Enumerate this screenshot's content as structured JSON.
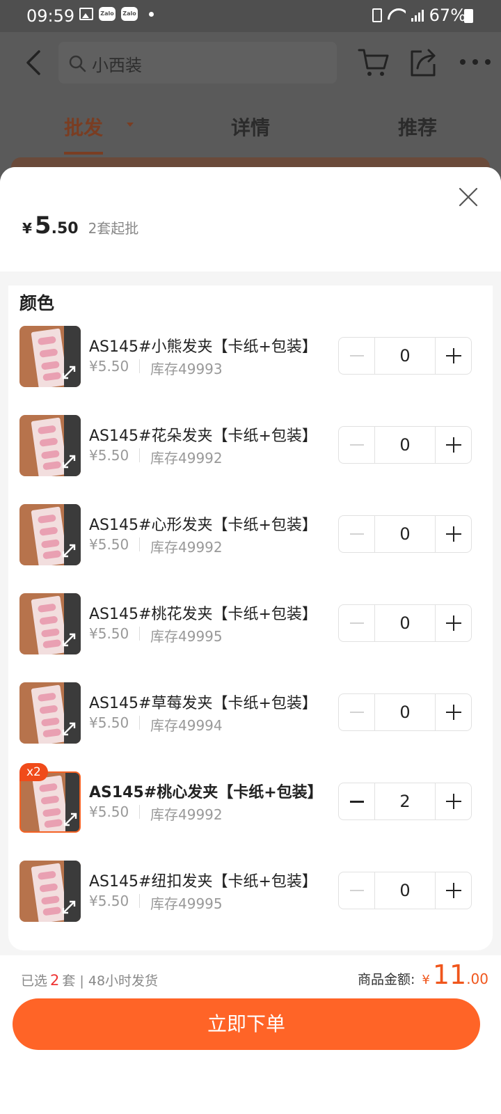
{
  "status_bar": {
    "time": "09:59",
    "battery": "67%",
    "zalo_label": "Zalo"
  },
  "top_bar": {
    "search_placeholder": "小西装"
  },
  "tabs": [
    {
      "label": "批发",
      "active": true
    },
    {
      "label": "详情",
      "active": false
    },
    {
      "label": "推荐",
      "active": false
    }
  ],
  "sheet": {
    "price_symbol": "¥",
    "price_int": "5",
    "price_dec": ".50",
    "moq": "2套起批",
    "section_title": "颜色"
  },
  "items": [
    {
      "name": "AS145#小熊发夹【卡纸+包装】",
      "price": "¥5.50",
      "stock": "库存49993",
      "qty": "0"
    },
    {
      "name": "AS145#花朵发夹【卡纸+包装】",
      "price": "¥5.50",
      "stock": "库存49992",
      "qty": "0"
    },
    {
      "name": "AS145#心形发夹【卡纸+包装】",
      "price": "¥5.50",
      "stock": "库存49992",
      "qty": "0"
    },
    {
      "name": "AS145#桃花发夹【卡纸+包装】",
      "price": "¥5.50",
      "stock": "库存49995",
      "qty": "0"
    },
    {
      "name": "AS145#草莓发夹【卡纸+包装】",
      "price": "¥5.50",
      "stock": "库存49994",
      "qty": "0"
    },
    {
      "name": "AS145#桃心发夹【卡纸+包装】",
      "price": "¥5.50",
      "stock": "库存49992",
      "qty": "2",
      "badge": "x2",
      "selected": true
    },
    {
      "name": "AS145#纽扣发夹【卡纸+包装】",
      "price": "¥5.50",
      "stock": "库存49995",
      "qty": "0"
    }
  ],
  "footer": {
    "selected_prefix": "已选",
    "selected_count": "2",
    "selected_suffix": "套 | 48小时发货",
    "total_label": "商品金额:",
    "total_symbol": "¥",
    "total_int": "11",
    "total_dec": ".00",
    "order_button": "立即下单"
  },
  "colors": {
    "accent": "#ff6427",
    "price_red": "#f0561c",
    "badge": "#f04b1a"
  }
}
